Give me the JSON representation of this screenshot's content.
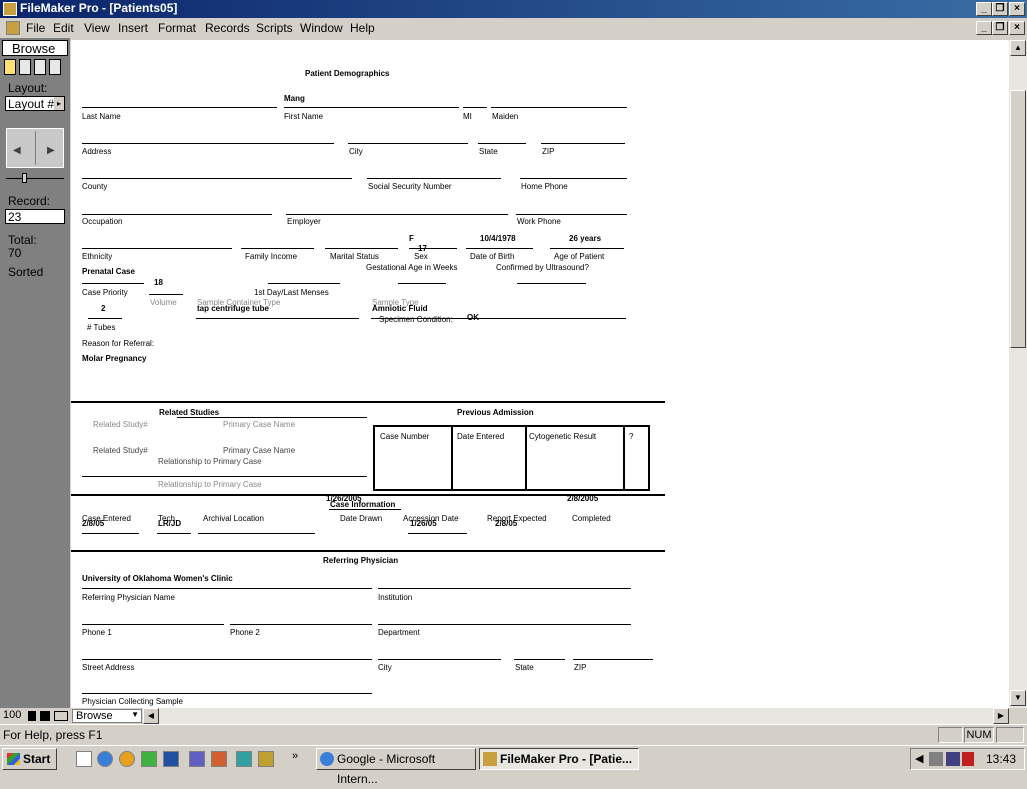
{
  "window": {
    "title": "FileMaker Pro - [Patients05]"
  },
  "menu": [
    "File",
    "Edit",
    "View",
    "Insert",
    "Format",
    "Records",
    "Scripts",
    "Window",
    "Help"
  ],
  "status_area": {
    "mode": "Browse",
    "layout_label": "Layout:",
    "layout_value": "Layout #",
    "record_label": "Record:",
    "record_value": "23",
    "total_label": "Total:",
    "total_value": "70",
    "sorted_label": "Sorted"
  },
  "form": {
    "title": "Patient Demographics",
    "first_name": "Mang",
    "sex": "F",
    "dob": "10/4/1978",
    "age": "26 years",
    "gest_age": "17",
    "volume": "18",
    "tubes": "2",
    "container": "tap centrifuge tube",
    "sample_type": "Amniotic Fluid",
    "specimen_condition": "OK",
    "reason": "Molar Pregnancy",
    "labels": {
      "last_name": "Last Name",
      "first_name": "First Name",
      "mi": "MI",
      "maiden": "Maiden",
      "address": "Address",
      "city": "City",
      "state": "State",
      "zip": "ZIP",
      "county": "County",
      "ssn": "Social Security Number",
      "home_phone": "Home Phone",
      "occupation": "Occupation",
      "employer": "Employer",
      "work_phone": "Work Phone",
      "ethnicity": "Ethnicity",
      "family_income": "Family Income",
      "marital": "Marital Status",
      "sex": "Sex",
      "dob": "Date of Birth",
      "age": "Age of Patient",
      "prenatal": "Prenatal Case",
      "gest": "Gestational Age in Weeks",
      "confirmed": "Confirmed by Ultrasound?",
      "priority": "Case Priority",
      "volume": "Volume",
      "container": "Sample Container Type",
      "lmp": "1st Day/Last Menses",
      "sample_type": "Sample Type",
      "tubes": "# Tubes",
      "specimen": "Specimen Condition:",
      "reason": "Reason for Referral:"
    },
    "related": {
      "title": "Related Studies",
      "related_study": "Related Study#",
      "primary_case": "Primary Case Name",
      "relationship": "Relationship to Primary Case",
      "relationship_ghost": "Relationship to Primary Case"
    },
    "previous": {
      "title": "Previous Admission",
      "headers": [
        "Case Number",
        "Date Entered",
        "Cytogenetic Result",
        "?"
      ]
    },
    "case_info": {
      "title": "Case Information",
      "case_entered": "2/8/05",
      "tech": "LR/JD",
      "date_drawn": "1/26/2005",
      "accession": "1/26/05",
      "report_expected": "2/8/05",
      "completed": "2/8/2005",
      "labels": {
        "case_entered": "Case Entered",
        "tech": "Tech",
        "archival": "Archival Location",
        "date_drawn": "Date Drawn",
        "accession": "Accession Date",
        "report_expected": "Report Expected",
        "completed": "Completed"
      }
    },
    "physician": {
      "title": "Referring Physician",
      "institution_value": "University of Oklahoma Women's Clinic",
      "labels": {
        "name": "Referring Physician Name",
        "institution": "Institution",
        "phone1": "Phone 1",
        "phone2": "Phone 2",
        "dept": "Department",
        "street": "Street Address",
        "city": "City",
        "state": "State",
        "zip": "ZIP",
        "collecting": "Physician Collecting Sample"
      }
    }
  },
  "bottom": {
    "zoom": "100",
    "mode_select": "Browse"
  },
  "statusbar": {
    "help": "For Help, press F1",
    "num": "NUM"
  },
  "taskbar": {
    "start": "Start",
    "tasks": [
      "Google - Microsoft Intern...",
      "FileMaker Pro - [Patie..."
    ],
    "clock": "13:43"
  }
}
